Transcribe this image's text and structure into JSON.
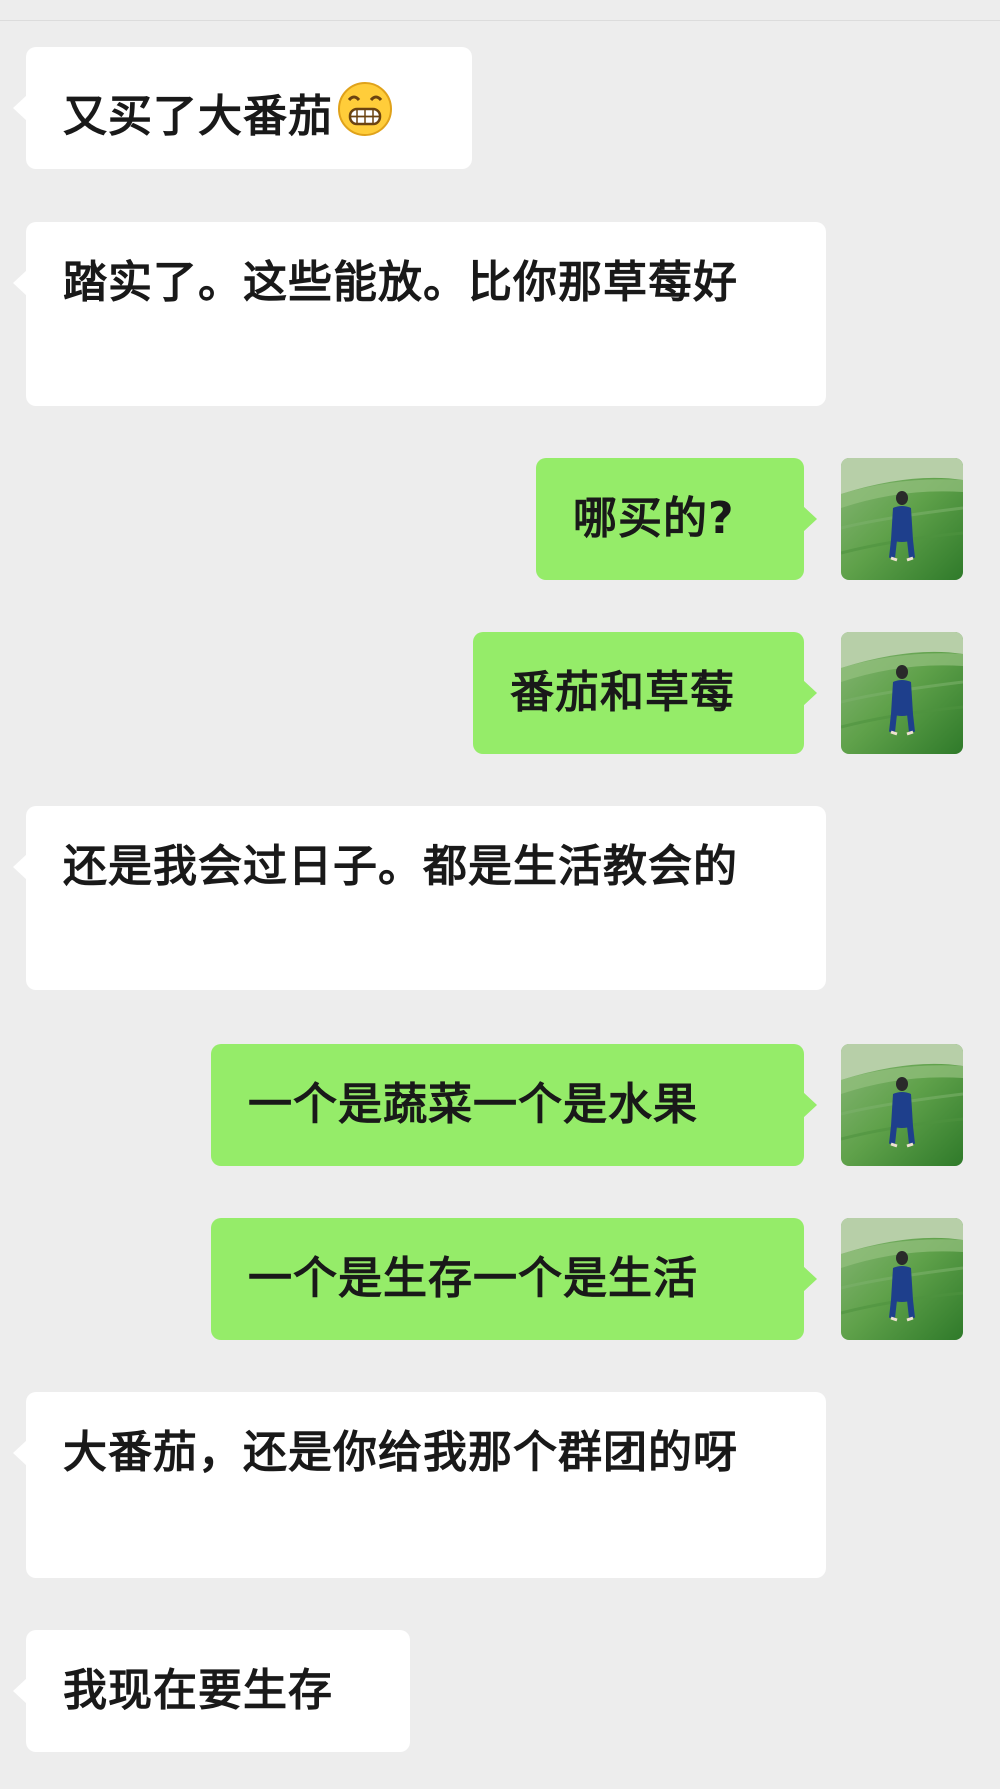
{
  "messages": [
    {
      "side": "in",
      "text": "又买了大番茄",
      "emoji": "grinning-face-emoji"
    },
    {
      "side": "in",
      "text": "踏实了。这些能放。比你那草莓好"
    },
    {
      "side": "out",
      "text": "哪买的?"
    },
    {
      "side": "out",
      "text": "番茄和草莓"
    },
    {
      "side": "in",
      "text": "还是我会过日子。都是生活教会的"
    },
    {
      "side": "out",
      "text": "一个是蔬菜一个是水果"
    },
    {
      "side": "out",
      "text": "一个是生存一个是生活"
    },
    {
      "side": "in",
      "text": "大番茄，还是你给我那个群团的呀"
    },
    {
      "side": "in",
      "text": "我现在要生存"
    }
  ],
  "colors": {
    "background": "#ededed",
    "incoming_bubble": "#ffffff",
    "outgoing_bubble": "#95ec69",
    "text": "#191919"
  },
  "avatar": {
    "icon": "user-avatar-photo"
  }
}
